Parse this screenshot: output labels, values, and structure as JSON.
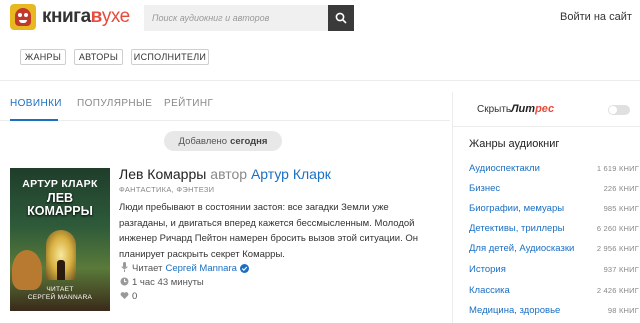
{
  "header": {
    "brand_prefix": "книга",
    "brand_v": "в",
    "brand_suffix": "ухе",
    "search_placeholder": "Поиск аудиокниг и авторов",
    "login": "Войти на сайт"
  },
  "filters": [
    "ЖАНРЫ",
    "АВТОРЫ",
    "ИСПОЛНИТЕЛИ"
  ],
  "tabs": [
    {
      "label": "НОВИНКИ",
      "active": true
    },
    {
      "label": "ПОПУЛЯРНЫЕ",
      "active": false
    },
    {
      "label": "РЕЙТИНГ",
      "active": false
    }
  ],
  "added_badge": {
    "prefix": "Добавлено",
    "day": "сегодня"
  },
  "book": {
    "cover_author": "АРТУР КЛАРК",
    "cover_title_1": "ЛЕВ",
    "cover_title_2": "КОМАРРЫ",
    "cover_reader_1": "ЧИТАЕТ",
    "cover_reader_2": "СЕРГЕЙ MANNARA",
    "title": "Лев Комарры",
    "by": "автор",
    "author": "Артур Кларк",
    "genres": "ФАНТАСТИКА, ФЭНТЕЗИ",
    "description": "Люди пребывают в состоянии застоя: все загадки Земли уже разгаданы, и двигаться вперед кажется бессмысленным. Молодой инженер Ричард Пейтон намерен бросить вызов этой ситуации. Он планирует раскрыть секрет Комарры.",
    "reader_label": "Читает",
    "reader": "Сергей Mannara",
    "duration": "1 час 43 минуты",
    "likes": "0"
  },
  "sidebar": {
    "litres_label": "Скрыть",
    "litres_brand_a": "Лит",
    "litres_brand_b": "рес",
    "litres_hidden": false,
    "genres_heading": "Жанры аудиокниг",
    "genres": [
      {
        "name": "Аудиоспектакли",
        "count": "1 619 КНИГ"
      },
      {
        "name": "Бизнес",
        "count": "226 КНИГ"
      },
      {
        "name": "Биографии, мемуары",
        "count": "985 КНИГ"
      },
      {
        "name": "Детективы, триллеры",
        "count": "6 260 КНИГ"
      },
      {
        "name": "Для детей, Аудиосказки",
        "count": "2 956 КНИГ"
      },
      {
        "name": "История",
        "count": "937 КНИГ"
      },
      {
        "name": "Классика",
        "count": "2 426 КНИГ"
      },
      {
        "name": "Медицина, здоровье",
        "count": "98 КНИГ"
      }
    ]
  },
  "colors": {
    "accent": "#1a6fc4",
    "brand_red": "#e74c3c",
    "search_button": "#3a3a3a"
  }
}
